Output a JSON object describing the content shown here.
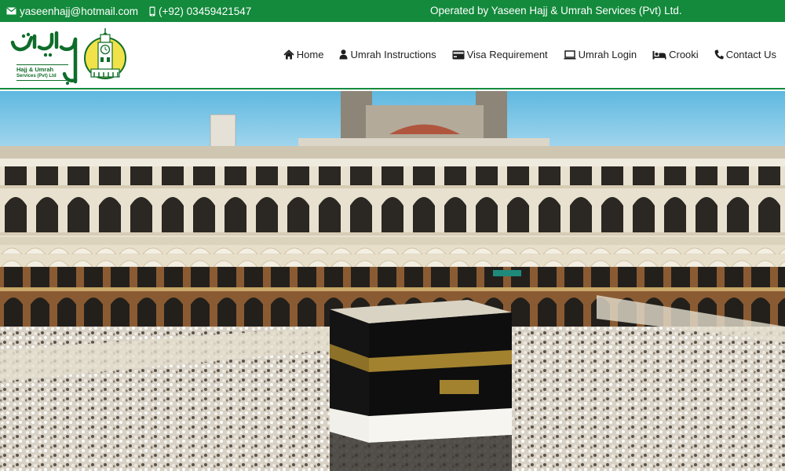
{
  "topbar": {
    "email": "yaseenhajj@hotmail.com",
    "phone": "(+92) 03459421547",
    "operated_by": "Operated by Yaseen Hajj & Umrah Services (Pvt) Ltd."
  },
  "logo": {
    "line1": "Hajj & Umrah",
    "line2": "Services (Pvt) Ltd"
  },
  "nav": [
    {
      "label": "Home",
      "icon": "home-icon"
    },
    {
      "label": "Umrah Instructions",
      "icon": "user-icon"
    },
    {
      "label": "Visa Requirement",
      "icon": "credit-card-icon"
    },
    {
      "label": "Umrah Login",
      "icon": "laptop-icon"
    },
    {
      "label": "Crooki",
      "icon": "bed-icon"
    },
    {
      "label": "Contact Us",
      "icon": "phone-icon"
    }
  ],
  "colors": {
    "brand_green": "#138a3c",
    "logo_yellow": "#f1e24a"
  }
}
